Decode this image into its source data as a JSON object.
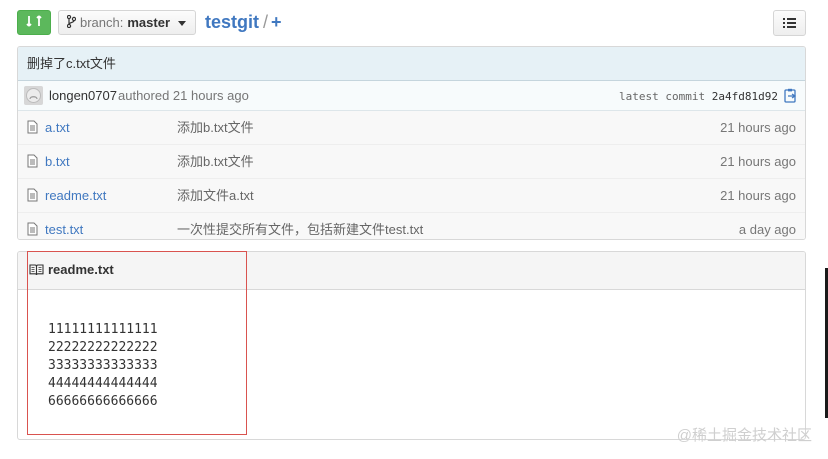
{
  "toolbar": {
    "branch_label": "branch:",
    "branch_value": "master",
    "repo_name": "testgit",
    "path_sep": "/",
    "add_label": "+"
  },
  "commit": {
    "message": "删掉了c.txt文件",
    "author": "longen0707",
    "authored_text": "authored 21 hours ago",
    "latest_label": "latest commit",
    "sha": "2a4fd81d92"
  },
  "files": [
    {
      "name": "a.txt",
      "message": "添加b.txt文件",
      "age": "21 hours ago"
    },
    {
      "name": "b.txt",
      "message": "添加b.txt文件",
      "age": "21 hours ago"
    },
    {
      "name": "readme.txt",
      "message": "添加文件a.txt",
      "age": "21 hours ago"
    },
    {
      "name": "test.txt",
      "message": "一次性提交所有文件，包括新建文件test.txt",
      "age": "a day ago"
    }
  ],
  "readme": {
    "title": "readme.txt",
    "lines": [
      "11111111111111",
      "22222222222222",
      "33333333333333",
      "44444444444444",
      "66666666666666"
    ]
  },
  "watermark": "@稀土掘金技术社区",
  "colors": {
    "accent": "#4078c0",
    "compare": "#5cb85c",
    "highlight_box": "#d9534f"
  }
}
